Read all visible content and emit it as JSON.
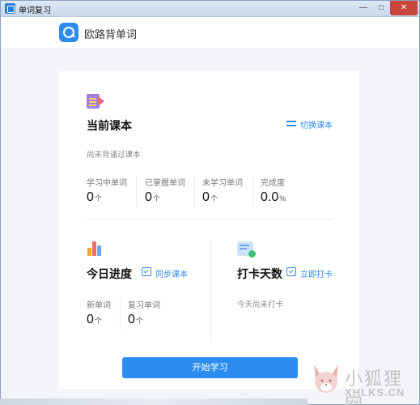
{
  "window": {
    "title": "单词复习",
    "minimize": "—",
    "maximize": "□",
    "close": "✕"
  },
  "header": {
    "app_name": "欧路背单词",
    "logo_icon": "search-bubble-icon"
  },
  "current_book": {
    "title": "当前课本",
    "switch_label": "切换课本",
    "status": "尚未背诵过课本",
    "stats": [
      {
        "label": "学习中单词",
        "value": "0",
        "unit": "个"
      },
      {
        "label": "已掌握单词",
        "value": "0",
        "unit": "个"
      },
      {
        "label": "未学习单词",
        "value": "0",
        "unit": "个"
      },
      {
        "label": "完成度",
        "value": "0.0",
        "unit": "%"
      }
    ]
  },
  "today": {
    "title": "今日进度",
    "sync_label": "同步课本",
    "stats": [
      {
        "label": "新单词",
        "value": "0",
        "unit": "个"
      },
      {
        "label": "复习单词",
        "value": "0",
        "unit": "个"
      }
    ]
  },
  "checkin": {
    "title": "打卡天数",
    "action_label": "立即打卡",
    "status": "今天尚未打卡"
  },
  "start_button": "开始学习",
  "watermark": {
    "cn": "小狐狸网",
    "en": "XHLKS.CN"
  },
  "colors": {
    "accent": "#2c8cf0",
    "title_text": "#111111",
    "muted_text": "#888888"
  }
}
